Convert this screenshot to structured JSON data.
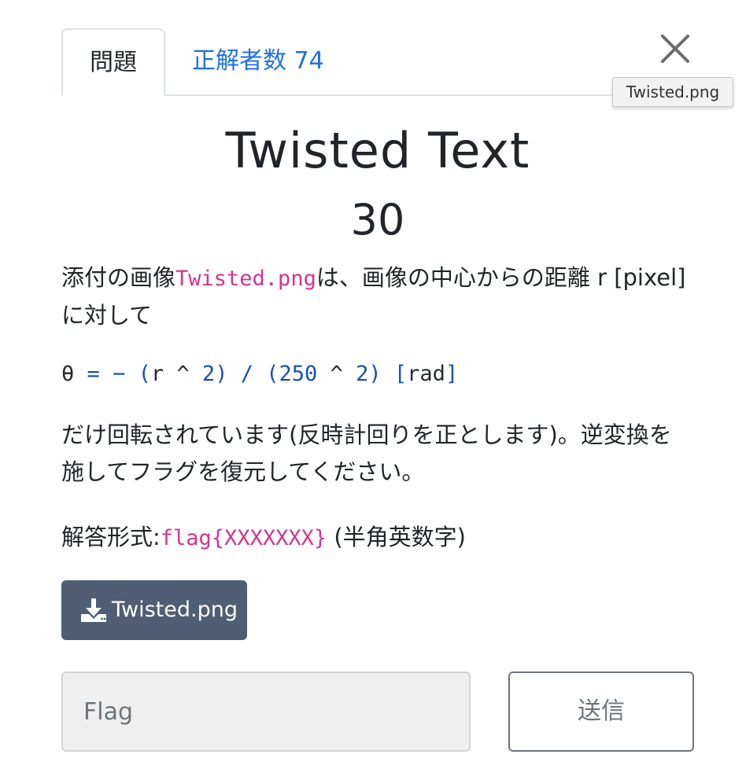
{
  "tabs": {
    "problem_label": "問題",
    "solvers_label": "正解者数 74"
  },
  "tooltip": {
    "text": "Twisted.png"
  },
  "challenge": {
    "title": "Twisted Text",
    "points": "30"
  },
  "description": {
    "p1_before": "添付の画像",
    "p1_code": "Twisted.png",
    "p1_after": "は、画像の中心からの距離 r [pixel] に対して",
    "formula": {
      "theta": "θ",
      "eq": "=",
      "minus": "−",
      "lp1": "(",
      "r": "r",
      "pow1": "^",
      "two1": "2",
      "rp1": ")",
      "div": "/",
      "lp2": "(",
      "n250": "250",
      "pow2": "^",
      "two2": "2",
      "rp2": ")",
      "lb": "[",
      "rad": "rad",
      "rb": "]"
    },
    "p2": "だけ回転されています(反時計回りを正とします)。逆変換を施してフラグを復元してください。",
    "p3_before": "解答形式:",
    "p3_code": "flag{XXXXXXX}",
    "p3_after": " (半角英数字)"
  },
  "download": {
    "label": "Twisted.png",
    "icon": "download-icon"
  },
  "form": {
    "flag_placeholder": "Flag",
    "flag_value": "",
    "submit_label": "送信"
  },
  "colors": {
    "link": "#1f6fe5",
    "code": "#d6338c",
    "button_bg": "#4f5d75",
    "formula_op": "#1a4fb8"
  }
}
